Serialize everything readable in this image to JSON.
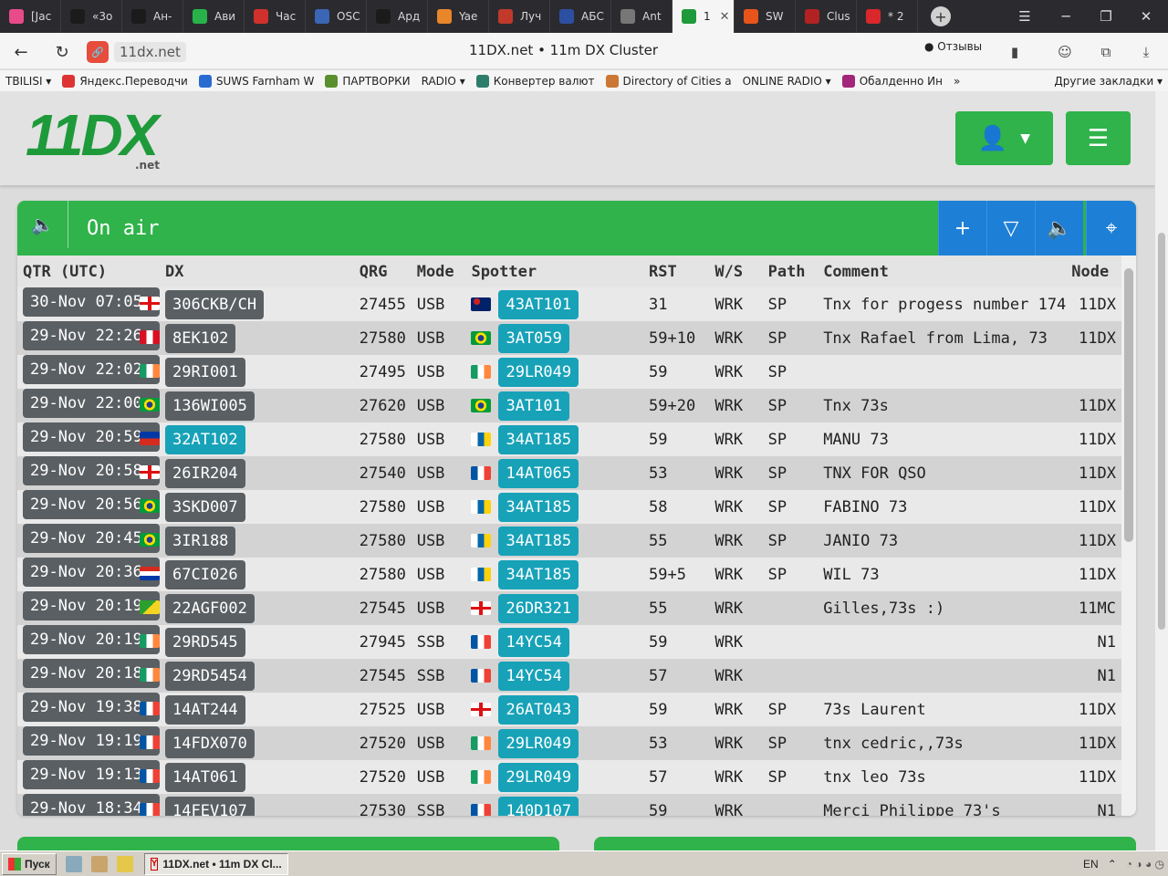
{
  "browser": {
    "tabs": [
      {
        "label": "[Jac",
        "icon": "pink-app-icon",
        "color": "#e84b8a"
      },
      {
        "label": "«3o",
        "icon": "star-icon",
        "color": "#1b1b1b"
      },
      {
        "label": "Ан-",
        "icon": "star-icon",
        "color": "#1b1b1b"
      },
      {
        "label": "Ави",
        "icon": "flight-icon",
        "color": "#27b34a"
      },
      {
        "label": "Час",
        "icon": "red-r-icon",
        "color": "#d0312d"
      },
      {
        "label": "OSC",
        "icon": "pen-icon",
        "color": "#3b65b5"
      },
      {
        "label": "Ард",
        "icon": "star-icon",
        "color": "#1b1b1b"
      },
      {
        "label": "Yae",
        "icon": "g-icon",
        "color": "#e8862a"
      },
      {
        "label": "Луч",
        "icon": "cqham-icon",
        "color": "#c0392b"
      },
      {
        "label": "АБС",
        "icon": "flag-fi-icon",
        "color": "#2d4fa2"
      },
      {
        "label": "Ant",
        "icon": "antenna-icon",
        "color": "#777777"
      },
      {
        "label": "1",
        "icon": "11dx-icon",
        "color": "#1e9a3a",
        "active": true
      },
      {
        "label": "SW",
        "icon": "orange-circle-icon",
        "color": "#e8541a"
      },
      {
        "label": "Clus",
        "icon": "dxspot-icon",
        "color": "#b22222"
      },
      {
        "label": "* 2",
        "icon": "flag-vn-icon",
        "color": "#d8282b"
      }
    ],
    "address": {
      "domain": "11dx.net",
      "page_title": "11DX.net • 11m DX Cluster",
      "feedback_label": "Отзывы"
    },
    "bookmarks": [
      {
        "label": "TBILISI ▾",
        "color": ""
      },
      {
        "label": "Яндекс.Переводчи",
        "color": "#d33"
      },
      {
        "label": "SUWS Farnham W",
        "color": "#2a6bd1"
      },
      {
        "label": "ПАРТВОРКИ",
        "color": "#5a8f2e"
      },
      {
        "label": "RADIO ▾",
        "color": ""
      },
      {
        "label": "Конвертер валют",
        "color": "#2e7d6b"
      },
      {
        "label": "Directory of Cities a",
        "color": "#c73"
      },
      {
        "label": "ONLINE RADIO ▾",
        "color": ""
      },
      {
        "label": "Обалденно Ин",
        "color": "#a2267a"
      },
      {
        "label": "»",
        "color": ""
      },
      {
        "label": "Другие закладки ▾",
        "color": ""
      }
    ]
  },
  "site": {
    "logo_text": "11DX",
    "logo_suffix": ".net",
    "panel_title": "On air",
    "colors": {
      "green": "#2fb34a",
      "blue": "#1e7fd6",
      "teal": "#17a2b8",
      "chip": "#5a5f63"
    }
  },
  "table": {
    "headers": {
      "qtr": "QTR (UTC)",
      "dx": "DX",
      "qrg": "QRG",
      "mode": "Mode",
      "spotter": "Spotter",
      "rst": "RST",
      "ws": "W/S",
      "path": "Path",
      "comment": "Comment",
      "node": "Node"
    },
    "rows": [
      {
        "qtr": "30-Nov 07:05",
        "dx_flag": "gb-eng",
        "dx": "306CKB/CH",
        "dx_blue": false,
        "qrg": "27455",
        "mode": "USB",
        "sp_flag": "au",
        "spotter": "43AT101",
        "rst": "31",
        "ws": "WRK",
        "path": "SP",
        "comment": "Tnx for progess number 174",
        "node": "11DX"
      },
      {
        "qtr": "29-Nov 22:26",
        "dx_flag": "pe",
        "dx": "8EK102",
        "dx_blue": false,
        "qrg": "27580",
        "mode": "USB",
        "sp_flag": "br",
        "spotter": "3AT059",
        "rst": "59+10",
        "ws": "WRK",
        "path": "SP",
        "comment": "Tnx Rafael from Lima, 73",
        "node": "11DX"
      },
      {
        "qtr": "29-Nov 22:02",
        "dx_flag": "ie",
        "dx": "29RI001",
        "dx_blue": false,
        "qrg": "27495",
        "mode": "USB",
        "sp_flag": "ie",
        "spotter": "29LR049",
        "rst": "59",
        "ws": "WRK",
        "path": "SP",
        "comment": "",
        "node": ""
      },
      {
        "qtr": "29-Nov 22:00",
        "dx_flag": "br",
        "dx": "136WI005",
        "dx_blue": false,
        "qrg": "27620",
        "mode": "USB",
        "sp_flag": "br",
        "spotter": "3AT101",
        "rst": "59+20",
        "ws": "WRK",
        "path": "SP",
        "comment": "Tnx 73s",
        "node": "11DX"
      },
      {
        "qtr": "29-Nov 20:59",
        "dx_flag": "cl",
        "dx": "32AT102",
        "dx_blue": true,
        "qrg": "27580",
        "mode": "USB",
        "sp_flag": "ic",
        "spotter": "34AT185",
        "rst": "59",
        "ws": "WRK",
        "path": "SP",
        "comment": "MANU 73",
        "node": "11DX"
      },
      {
        "qtr": "29-Nov 20:58",
        "dx_flag": "gb-eng",
        "dx": "26IR204",
        "dx_blue": false,
        "qrg": "27540",
        "mode": "USB",
        "sp_flag": "fr",
        "spotter": "14AT065",
        "rst": "53",
        "ws": "WRK",
        "path": "SP",
        "comment": "TNX FOR QSO",
        "node": "11DX"
      },
      {
        "qtr": "29-Nov 20:56",
        "dx_flag": "br",
        "dx": "3SKD007",
        "dx_blue": false,
        "qrg": "27580",
        "mode": "USB",
        "sp_flag": "ic",
        "spotter": "34AT185",
        "rst": "58",
        "ws": "WRK",
        "path": "SP",
        "comment": "FABINO 73",
        "node": "11DX"
      },
      {
        "qtr": "29-Nov 20:45",
        "dx_flag": "br",
        "dx": "3IR188",
        "dx_blue": false,
        "qrg": "27580",
        "mode": "USB",
        "sp_flag": "ic",
        "spotter": "34AT185",
        "rst": "55",
        "ws": "WRK",
        "path": "SP",
        "comment": "JANIO 73",
        "node": "11DX"
      },
      {
        "qtr": "29-Nov 20:36",
        "dx_flag": "py",
        "dx": "67CI026",
        "dx_blue": false,
        "qrg": "27580",
        "mode": "USB",
        "sp_flag": "ic",
        "spotter": "34AT185",
        "rst": "59+5",
        "ws": "WRK",
        "path": "SP",
        "comment": "WIL 73",
        "node": "11DX"
      },
      {
        "qtr": "29-Nov 20:19",
        "dx_flag": "gf",
        "dx": "22AGF002",
        "dx_blue": false,
        "qrg": "27545",
        "mode": "USB",
        "sp_flag": "gb-eng",
        "spotter": "26DR321",
        "rst": "55",
        "ws": "WRK",
        "path": "",
        "comment": "Gilles,73s :)",
        "node": "11MC"
      },
      {
        "qtr": "29-Nov 20:19",
        "dx_flag": "ie",
        "dx": "29RD545",
        "dx_blue": false,
        "qrg": "27945",
        "mode": "SSB",
        "sp_flag": "fr",
        "spotter": "14YC54",
        "rst": "59",
        "ws": "WRK",
        "path": "",
        "comment": "",
        "node": "N1"
      },
      {
        "qtr": "29-Nov 20:18",
        "dx_flag": "ie",
        "dx": "29RD5454",
        "dx_blue": false,
        "qrg": "27545",
        "mode": "SSB",
        "sp_flag": "fr",
        "spotter": "14YC54",
        "rst": "57",
        "ws": "WRK",
        "path": "",
        "comment": "",
        "node": "N1"
      },
      {
        "qtr": "29-Nov 19:38",
        "dx_flag": "fr",
        "dx": "14AT244",
        "dx_blue": false,
        "qrg": "27525",
        "mode": "USB",
        "sp_flag": "gb-eng",
        "spotter": "26AT043",
        "rst": "59",
        "ws": "WRK",
        "path": "SP",
        "comment": "73s Laurent",
        "node": "11DX"
      },
      {
        "qtr": "29-Nov 19:19",
        "dx_flag": "fr",
        "dx": "14FDX070",
        "dx_blue": false,
        "qrg": "27520",
        "mode": "USB",
        "sp_flag": "ie",
        "spotter": "29LR049",
        "rst": "53",
        "ws": "WRK",
        "path": "SP",
        "comment": "tnx cedric,,73s",
        "node": "11DX"
      },
      {
        "qtr": "29-Nov 19:13",
        "dx_flag": "fr",
        "dx": "14AT061",
        "dx_blue": false,
        "qrg": "27520",
        "mode": "USB",
        "sp_flag": "ie",
        "spotter": "29LR049",
        "rst": "57",
        "ws": "WRK",
        "path": "SP",
        "comment": "tnx leo 73s",
        "node": "11DX"
      },
      {
        "qtr": "29-Nov 18:34",
        "dx_flag": "fr",
        "dx": "14FEV107",
        "dx_blue": false,
        "qrg": "27530",
        "mode": "SSB",
        "sp_flag": "fr",
        "spotter": "140D107",
        "rst": "59",
        "ws": "WRK",
        "path": "",
        "comment": "Merci Philippe 73's",
        "node": "N1"
      }
    ]
  },
  "taskbar": {
    "start_label": "Пуск",
    "window_label": "11DX.net • 11m DX Cl...",
    "lang": "EN"
  }
}
